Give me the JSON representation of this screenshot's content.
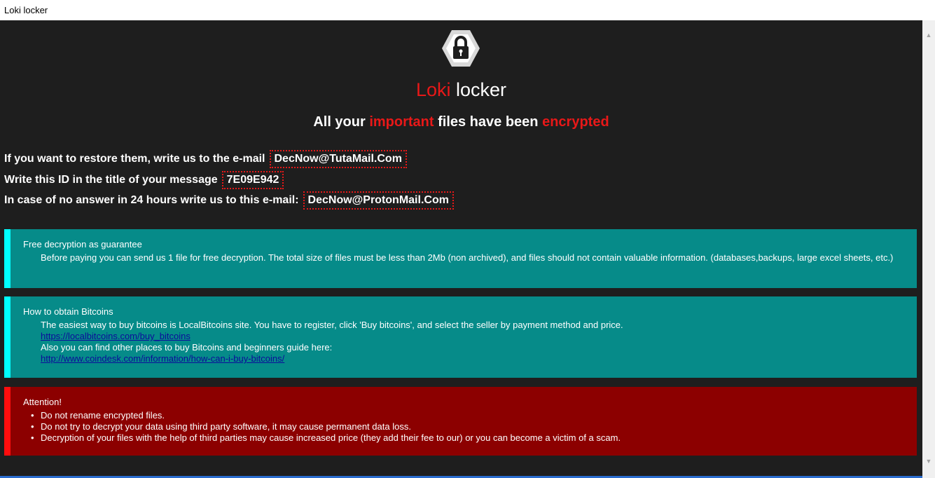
{
  "window": {
    "title": "Loki locker"
  },
  "header": {
    "title_red": "Loki",
    "title_white": "locker",
    "subtitle_1": "All your",
    "subtitle_important": "important",
    "subtitle_2": "files have been",
    "subtitle_encrypted": "encrypted"
  },
  "contact": {
    "line1_text": "If you want to restore them, write us to the e-mail",
    "line1_email": "DecNow@TutaMail.Com",
    "line2_text": "Write this ID in the title of your message",
    "line2_id": "7E09E942",
    "line3_text": "In case of no answer in 24 hours write us to this e-mail:",
    "line3_email": "DecNow@ProtonMail.Com"
  },
  "panels": {
    "free": {
      "heading": "Free decryption as guarantee",
      "body": "Before paying you can send us 1 file for free decryption. The total size of files must be less than 2Mb (non archived), and files should not contain valuable information. (databases,backups, large excel sheets, etc.)"
    },
    "bitcoin": {
      "heading": "How to obtain Bitcoins",
      "body1": "The easiest way to buy bitcoins is LocalBitcoins site. You have to register, click 'Buy bitcoins', and select the seller by payment method and price.",
      "link1": "https://localbitcoins.com/buy_bitcoins",
      "body2": "Also you can find other places to buy Bitcoins and beginners guide here:",
      "link2": "http://www.coindesk.com/information/how-can-i-buy-bitcoins/"
    },
    "attention": {
      "heading": "Attention!",
      "items": [
        "Do not rename encrypted files.",
        "Do not try to decrypt your data using third party software, it may cause permanent data loss.",
        "Decryption of your files with the help of third parties may cause increased price (they add their fee to our) or you can become a victim of a scam."
      ]
    }
  },
  "colors": {
    "background": "#1e1e1e",
    "accent_red": "#e81818",
    "teal_panel": "#068b89",
    "cyan_border": "#00ffff",
    "red_panel": "#8c0000",
    "red_border": "#ff0d0d"
  },
  "icons": {
    "logo": "padlock-hexagon-icon",
    "scroll_up": "chevron-up-icon",
    "scroll_down": "chevron-down-icon"
  }
}
